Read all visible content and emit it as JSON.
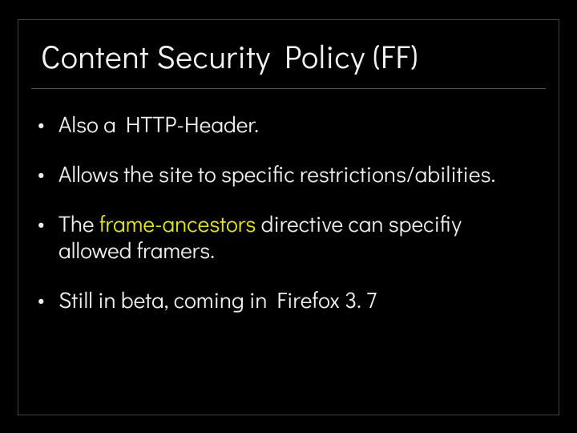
{
  "slide": {
    "title": "Content Security Policy (FF)",
    "bullets": [
      {
        "text": "Also a HTTP-Header."
      },
      {
        "text": "Allows the site to specific restrictions/abilities."
      },
      {
        "prefix": "The ",
        "highlight": "frame-ancestors",
        "suffix": " directive can specifiy allowed framers."
      },
      {
        "text": "Still in beta, coming in Firefox 3. 7"
      }
    ]
  }
}
